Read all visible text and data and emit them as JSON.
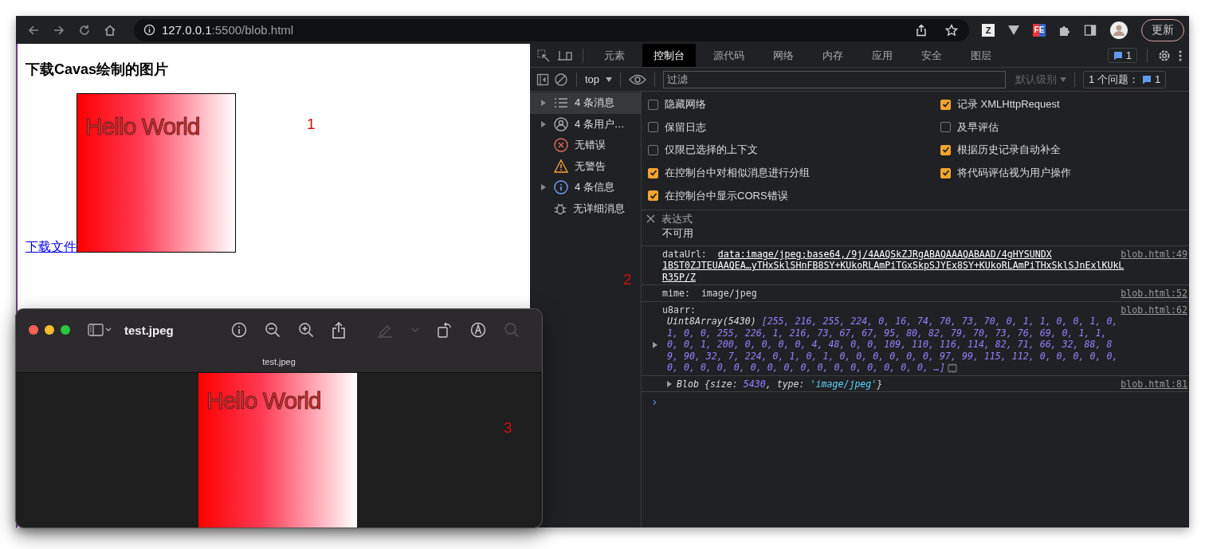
{
  "browser": {
    "url_host": "127.0.0.1",
    "url_path": ":5500/blob.html",
    "extensions": [
      {
        "kind": "z",
        "label": "Z"
      },
      {
        "kind": "v"
      },
      {
        "kind": "fe",
        "label": "FE"
      },
      {
        "kind": "puzzle"
      },
      {
        "kind": "sidebar"
      },
      {
        "kind": "avatar"
      }
    ],
    "update_button": "更新"
  },
  "page": {
    "heading": "下载Cavas绘制的图片",
    "canvas_text": "Hello World",
    "link": "下载文件"
  },
  "annotations": [
    {
      "label": "1"
    },
    {
      "label": "2"
    },
    {
      "label": "3"
    }
  ],
  "devtools": {
    "tabs": [
      {
        "label": "元素",
        "selected": false
      },
      {
        "label": "控制台",
        "selected": true
      },
      {
        "label": "源代码",
        "selected": false
      },
      {
        "label": "网络",
        "selected": false
      },
      {
        "label": "内存",
        "selected": false
      },
      {
        "label": "应用",
        "selected": false
      },
      {
        "label": "安全",
        "selected": false
      },
      {
        "label": "图层",
        "selected": false
      }
    ],
    "messages_badge": "1",
    "context": "top",
    "filter_placeholder": "过滤",
    "level_menu": "默认级别",
    "issues_label": "1 个问题：",
    "issues_count": "1",
    "sidebar": [
      {
        "kind": "list",
        "label": "4 条消息",
        "expandable": true,
        "selected": true
      },
      {
        "kind": "user",
        "label": "4 条用户…",
        "expandable": true,
        "selected": false
      },
      {
        "kind": "error",
        "label": "无错误",
        "expandable": false,
        "selected": false
      },
      {
        "kind": "warning",
        "label": "无警告",
        "expandable": false,
        "selected": false
      },
      {
        "kind": "info",
        "label": "4 条信息",
        "expandable": true,
        "selected": false
      },
      {
        "kind": "verbose",
        "label": "无详细消息",
        "expandable": false,
        "selected": false
      }
    ],
    "settings_left": [
      {
        "label": "隐藏网络",
        "checked": false
      },
      {
        "label": "保留日志",
        "checked": false
      },
      {
        "label": "仅限已选择的上下文",
        "checked": false
      },
      {
        "label": "在控制台中对相似消息进行分组",
        "checked": true
      },
      {
        "label": "在控制台中显示CORS错误",
        "checked": true
      }
    ],
    "settings_right": [
      {
        "label": "记录 XMLHttpRequest",
        "checked": true
      },
      {
        "label": "及早评估",
        "checked": false
      },
      {
        "label": "根据历史记录自动补全",
        "checked": true
      },
      {
        "label": "将代码评估视为用户操作",
        "checked": true
      }
    ],
    "live_expression": {
      "placeholder": "表达式",
      "value": "不可用"
    },
    "messages": [
      {
        "kind": "dataurl",
        "label": "dataUrl:",
        "link_lines": [
          "data:image/jpeg;base64,/9j/4AAQSkZJRgABAQAAAQABAAD/4gHYSUNDX",
          "1BST0ZJTEUAAQEA…yTHxSklSHnFB8SY+KUkoRLAmPiTGxSkpSJYEx8SY+KUkoRLAmPiTHxSklSJnExlKUkL",
          "R35P/Z"
        ],
        "source": "blob.html:49"
      },
      {
        "kind": "text",
        "label": "mime:",
        "value": "image/jpeg",
        "source": "blob.html:52"
      },
      {
        "kind": "array",
        "label": "u8arr:",
        "type": "Uint8Array(5430)",
        "lines": [
          "[255, 216, 255, 224, 0, 16, 74, 70, 73, 70, 0, 1, 1, 0, 0, 1, 0,",
          "1, 0, 0, 255, 226, 1, 216, 73, 67, 67, 95, 80, 82, 79, 70, 73, 76, 69, 0, 1, 1,",
          "0, 0, 1, 200, 0, 0, 0, 0, 4, 48, 0, 0, 109, 110, 116, 114, 82, 71, 66, 32, 88, 8",
          "9, 90, 32, 7, 224, 0, 1, 0, 1, 0, 0, 0, 0, 0, 0, 97, 99, 115, 112, 0, 0, 0, 0, 0,",
          "0, 0, 0, 0, 0, 0, 0, 0, 0, 0, 0, 0, 0, 0, 0, 0, …]"
        ],
        "source": "blob.html:62"
      },
      {
        "kind": "object",
        "name": "Blob",
        "tokens": [
          {
            "t": "{size: ",
            "kind": "punct"
          },
          {
            "t": "5430",
            "kind": "number"
          },
          {
            "t": ", type: ",
            "kind": "punct"
          },
          {
            "t": "'image/jpeg'",
            "kind": "string"
          },
          {
            "t": "}",
            "kind": "punct"
          }
        ],
        "source": "blob.html:81"
      }
    ],
    "prompt": "›"
  },
  "preview": {
    "title": "test.jpeg",
    "tab_title": "test.jpeg",
    "canvas_text": "Hello World"
  }
}
